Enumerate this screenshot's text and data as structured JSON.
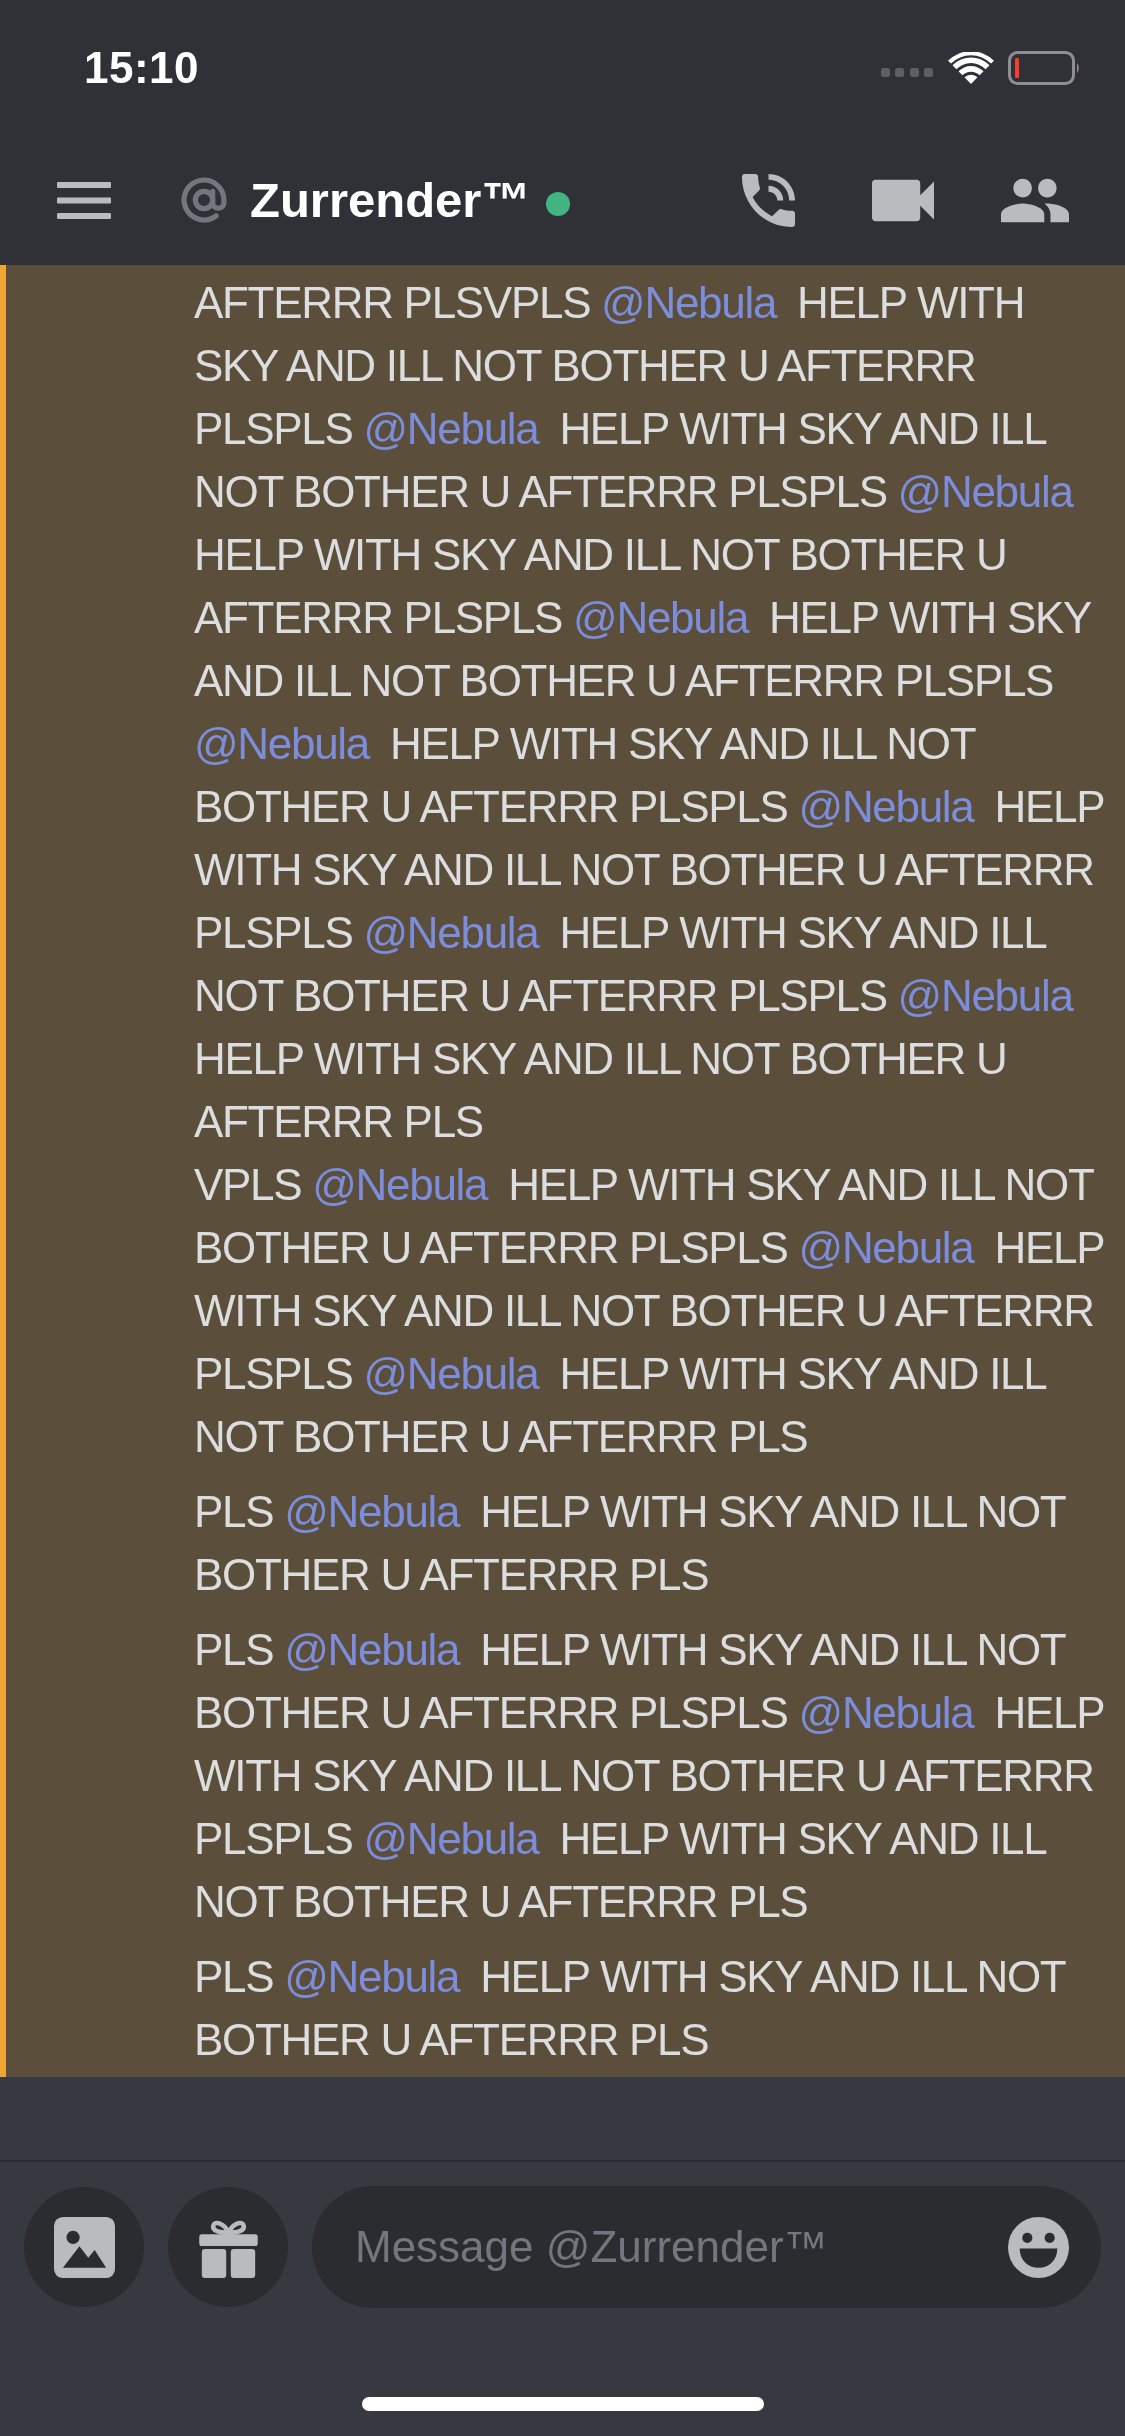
{
  "status_bar": {
    "time": "15:10"
  },
  "header": {
    "channel_name": "Zurrender™",
    "online": true
  },
  "messages": [
    {
      "mentioned": true,
      "lines": [
        {
          "parts": [
            {
              "kind": "text",
              "text": "AFTERRR PLSVPLS "
            },
            {
              "kind": "mention",
              "text": "@Nebula"
            },
            {
              "kind": "text",
              "text": " HELP WITH SKY AND ILL NOT BOTHER U AFTERRR PLSPLS "
            },
            {
              "kind": "mention",
              "text": "@Nebula"
            },
            {
              "kind": "text",
              "text": " HELP WITH SKY AND ILL NOT BOTHER U AFTERRR PLSPLS "
            },
            {
              "kind": "mention",
              "text": "@Nebula"
            },
            {
              "kind": "text",
              "text": " HELP WITH SKY AND ILL NOT BOTHER U AFTERRR PLSPLS "
            },
            {
              "kind": "mention",
              "text": "@Nebula"
            },
            {
              "kind": "text",
              "text": " HELP WITH SKY AND ILL NOT BOTHER U AFTERRR PLSPLS "
            },
            {
              "kind": "mention",
              "text": "@Nebula"
            },
            {
              "kind": "text",
              "text": " HELP WITH SKY AND ILL NOT BOTHER U AFTERRR PLSPLS "
            },
            {
              "kind": "mention",
              "text": "@Nebula"
            },
            {
              "kind": "text",
              "text": " HELP WITH SKY AND ILL NOT BOTHER U AFTERRR PLSPLS "
            },
            {
              "kind": "mention",
              "text": "@Nebula"
            },
            {
              "kind": "text",
              "text": " HELP WITH SKY AND ILL NOT BOTHER U AFTERRR PLSPLS "
            },
            {
              "kind": "mention",
              "text": "@Nebula"
            },
            {
              "kind": "text",
              "text": " HELP WITH SKY AND ILL NOT BOTHER U AFTERRR PLS"
            }
          ]
        },
        {
          "parts": [
            {
              "kind": "text",
              "text": "VPLS "
            },
            {
              "kind": "mention",
              "text": "@Nebula"
            },
            {
              "kind": "text",
              "text": " HELP WITH SKY AND ILL NOT BOTHER U AFTERRR PLSPLS "
            },
            {
              "kind": "mention",
              "text": "@Nebula"
            },
            {
              "kind": "text",
              "text": " HELP WITH SKY AND ILL NOT BOTHER U AFTERRR PLSPLS "
            },
            {
              "kind": "mention",
              "text": "@Nebula"
            },
            {
              "kind": "text",
              "text": " HELP WITH SKY AND ILL NOT BOTHER U AFTERRR PLS"
            }
          ]
        }
      ]
    },
    {
      "mentioned": true,
      "lines": [
        {
          "parts": [
            {
              "kind": "text",
              "text": "PLS "
            },
            {
              "kind": "mention",
              "text": "@Nebula"
            },
            {
              "kind": "text",
              "text": " HELP WITH SKY AND ILL NOT BOTHER U AFTERRR PLS"
            }
          ]
        }
      ]
    },
    {
      "mentioned": true,
      "lines": [
        {
          "parts": [
            {
              "kind": "text",
              "text": "PLS "
            },
            {
              "kind": "mention",
              "text": "@Nebula"
            },
            {
              "kind": "text",
              "text": " HELP WITH SKY AND ILL NOT BOTHER U AFTERRR PLSPLS "
            },
            {
              "kind": "mention",
              "text": "@Nebula"
            },
            {
              "kind": "text",
              "text": " HELP WITH SKY AND ILL NOT BOTHER U AFTERRR PLSPLS "
            },
            {
              "kind": "mention",
              "text": "@Nebula"
            },
            {
              "kind": "text",
              "text": " HELP WITH SKY AND ILL NOT BOTHER U AFTERRR PLS"
            }
          ]
        }
      ]
    },
    {
      "mentioned": true,
      "lines": [
        {
          "parts": [
            {
              "kind": "text",
              "text": "PLS "
            },
            {
              "kind": "mention",
              "text": "@Nebula"
            },
            {
              "kind": "text",
              "text": " HELP WITH SKY AND ILL NOT BOTHER U AFTERRR PLS"
            }
          ]
        }
      ]
    }
  ],
  "composer": {
    "placeholder": "Message @Zurrender™"
  }
}
